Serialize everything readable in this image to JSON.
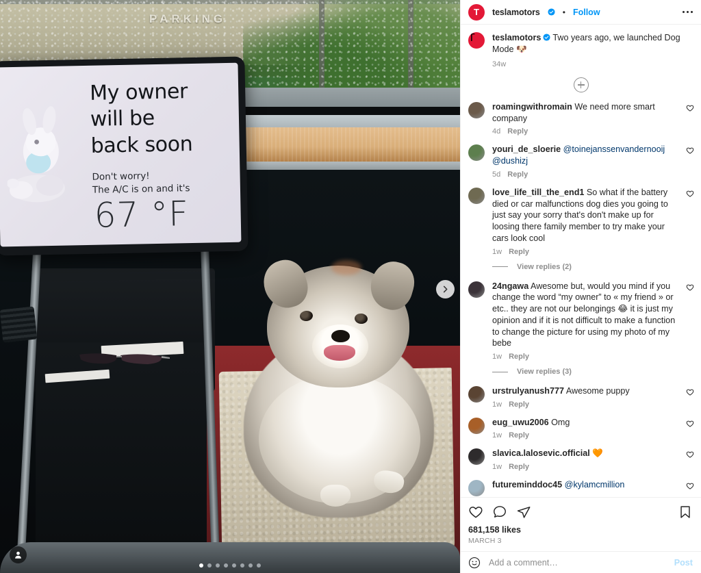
{
  "header": {
    "username": "teslamotors",
    "verified_icon": "verified-badge-icon",
    "separator": "•",
    "follow_label": "Follow",
    "more_label": "more-options-icon"
  },
  "caption": {
    "username": "teslamotors",
    "text": "Two years ago, we launched Dog Mode 🐶",
    "time": "34w"
  },
  "load_more": {
    "icon": "plus-circle-icon"
  },
  "comments": [
    {
      "username": "roamingwithromain",
      "text": "We need more smart company",
      "time": "4d",
      "reply_label": "Reply",
      "avatar_color": "#6b5a4a"
    },
    {
      "username": "youri_de_sloerie",
      "mention": "@toinejanssenvandernooij @dushizj",
      "text": "",
      "time": "5d",
      "reply_label": "Reply",
      "avatar_color": "#5d7f4e"
    },
    {
      "username": "love_life_till_the_end1",
      "text": "So what if the battery died or car malfunctions dog dies you going to just say your sorry that's don't make up for loosing there family member to try make your cars look cool",
      "time": "1w",
      "reply_label": "Reply",
      "view_replies": "View replies (2)",
      "avatar_color": "#6f6a52"
    },
    {
      "username": "24ngawa",
      "text": "Awesome but, would you mind if you change the word “my owner” to « my friend » or etc.. they are not our belongings 😂 it is just my opinion and if it is not difficult to make a function to change the picture for using my photo of my bebe",
      "time": "1w",
      "reply_label": "Reply",
      "view_replies": "View replies (3)",
      "avatar_color": "#3b3339"
    },
    {
      "username": "urstrulyanush777",
      "text": "Awesome puppy",
      "time": "1w",
      "reply_label": "Reply",
      "avatar_color": "#5a4433"
    },
    {
      "username": "eug_uwu2006",
      "text": "Omg",
      "time": "1w",
      "reply_label": "Reply",
      "avatar_color": "#a85f28"
    },
    {
      "username": "slavica.lalosevic.official",
      "text": "🧡",
      "time": "1w",
      "reply_label": "Reply",
      "avatar_color": "#2e2b2c"
    },
    {
      "username": "futureminddoc45",
      "mention": "@kylamcmillion",
      "text": "",
      "time": "",
      "reply_label": "",
      "avatar_color": "#9fb6c4"
    }
  ],
  "actions": {
    "like_icon": "heart-icon",
    "comment_icon": "comment-bubble-icon",
    "share_icon": "share-paper-plane-icon",
    "save_icon": "bookmark-icon",
    "likes_count": "681,158 likes",
    "date": "MARCH 3"
  },
  "add_comment": {
    "emoji_icon": "emoji-smiley-icon",
    "placeholder": "Add a comment…",
    "post_label": "Post"
  },
  "media": {
    "tag_icon": "tagged-people-icon",
    "next_icon": "chevron-right-icon",
    "carousel": {
      "total": 8,
      "active_index": 0
    },
    "background_sign": "PARKING",
    "screen": {
      "headline": "My owner\nwill be\nback soon",
      "sub_line1": "Don't worry!",
      "sub_line2": "The A/C is on and it's",
      "temperature": "67 °F"
    }
  },
  "colors": {
    "accent_blue": "#0095f6",
    "link_blue": "#00376b",
    "tesla_red": "#e31937",
    "text_primary": "#262626",
    "text_muted": "#8e8e8e"
  }
}
